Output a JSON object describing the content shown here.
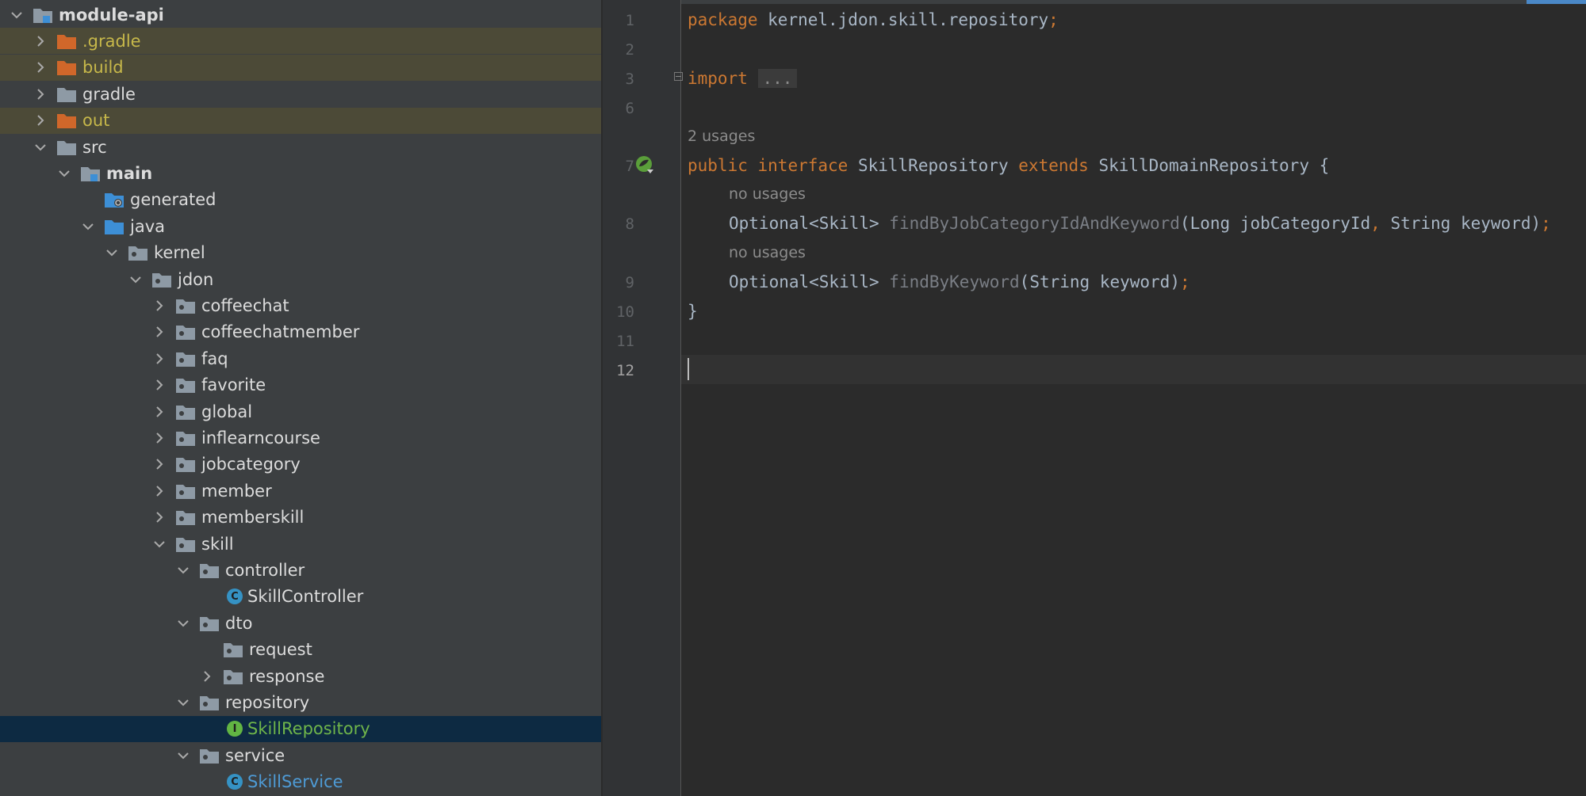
{
  "project_tree": [
    {
      "label": "module-api",
      "expanded": true,
      "icon": "module-folder-icon",
      "bold": true
    },
    {
      "label": ".gradle",
      "expanded": false,
      "icon": "excluded-folder-icon",
      "excluded": true
    },
    {
      "label": "build",
      "expanded": false,
      "icon": "excluded-folder-icon",
      "excluded": true
    },
    {
      "label": "gradle",
      "expanded": false,
      "icon": "folder-icon"
    },
    {
      "label": "out",
      "expanded": false,
      "icon": "excluded-folder-icon",
      "excluded": true
    },
    {
      "label": "src",
      "expanded": true,
      "icon": "folder-icon"
    },
    {
      "label": "main",
      "expanded": true,
      "icon": "module-folder-icon",
      "bold": true
    },
    {
      "label": "generated",
      "icon": "generated-folder-icon"
    },
    {
      "label": "java",
      "expanded": true,
      "icon": "source-folder-icon"
    },
    {
      "label": "kernel",
      "expanded": true,
      "icon": "package-icon"
    },
    {
      "label": "jdon",
      "expanded": true,
      "icon": "package-icon"
    },
    {
      "label": "coffeechat",
      "expanded": false,
      "icon": "package-icon"
    },
    {
      "label": "coffeechatmember",
      "expanded": false,
      "icon": "package-icon"
    },
    {
      "label": "faq",
      "expanded": false,
      "icon": "package-icon"
    },
    {
      "label": "favorite",
      "expanded": false,
      "icon": "package-icon"
    },
    {
      "label": "global",
      "expanded": false,
      "icon": "package-icon"
    },
    {
      "label": "inflearncourse",
      "expanded": false,
      "icon": "package-icon"
    },
    {
      "label": "jobcategory",
      "expanded": false,
      "icon": "package-icon"
    },
    {
      "label": "member",
      "expanded": false,
      "icon": "package-icon"
    },
    {
      "label": "memberskill",
      "expanded": false,
      "icon": "package-icon"
    },
    {
      "label": "skill",
      "expanded": true,
      "icon": "package-icon"
    },
    {
      "label": "controller",
      "expanded": true,
      "icon": "package-icon"
    },
    {
      "label": "SkillController",
      "icon": "class-icon"
    },
    {
      "label": "dto",
      "expanded": true,
      "icon": "package-icon"
    },
    {
      "label": "request",
      "icon": "package-icon"
    },
    {
      "label": "response",
      "expanded": false,
      "icon": "package-icon"
    },
    {
      "label": "repository",
      "expanded": true,
      "icon": "package-icon"
    },
    {
      "label": "SkillRepository",
      "icon": "interface-icon",
      "selected": true
    },
    {
      "label": "service",
      "expanded": true,
      "icon": "package-icon"
    },
    {
      "label": "SkillService",
      "icon": "class-icon"
    }
  ],
  "editor": {
    "line_numbers": [
      "1",
      "2",
      "3",
      "6",
      "7",
      "8",
      "9",
      "10",
      "11",
      "12"
    ],
    "current_line": "12",
    "code": {
      "pkg_kw": "package",
      "pkg_name": " kernel.jdon.skill.repository",
      "semi": ";",
      "import_kw": "import",
      "import_fold": "...",
      "public_kw": "public",
      "interface_kw": "interface",
      "iface_name": "SkillRepository",
      "extends_kw": "extends",
      "iface_tail": "SkillDomainRepository {",
      "m1_type": "Optional<Skill> ",
      "m1_name": "findByJobCategoryIdAndKeyword",
      "m1_args1": "(Long jobCategoryId",
      "m1_comma": ",",
      "m1_args2": " String keyword)",
      "m2_type": "Optional<Skill> ",
      "m2_name": "findByKeyword",
      "m2_args": "(String keyword)",
      "close_brace": "}"
    },
    "hints": {
      "iface_usages": "2 usages",
      "m1_usages": "no usages",
      "m2_usages": "no usages"
    }
  }
}
